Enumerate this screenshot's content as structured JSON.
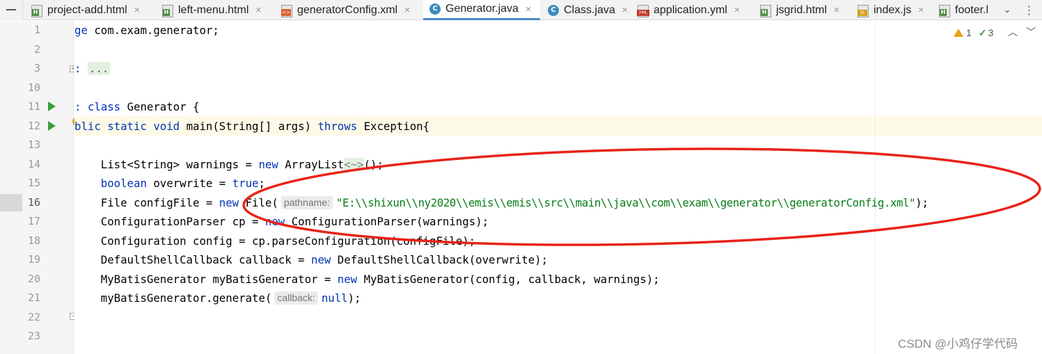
{
  "tabs": [
    {
      "label": "project-add.html",
      "icon": "html-file-icon",
      "close": "×"
    },
    {
      "label": "left-menu.html",
      "icon": "html-file-icon",
      "close": "×"
    },
    {
      "label": "generatorConfig.xml",
      "icon": "xml-file-icon",
      "close": "×"
    },
    {
      "label": "Generator.java",
      "icon": "java-class-icon",
      "close": "×",
      "active": true
    },
    {
      "label": "Class.java",
      "icon": "java-class-icon",
      "close": "×"
    },
    {
      "label": "application.yml",
      "icon": "yml-file-icon",
      "close": "×"
    },
    {
      "label": "jsgrid.html",
      "icon": "html-file-icon",
      "close": "×"
    },
    {
      "label": "index.js",
      "icon": "js-file-icon",
      "close": "×"
    },
    {
      "label": "footer.l",
      "icon": "html-file-icon"
    }
  ],
  "tabs_more_glyph": "⌄",
  "tabs_options_glyph": "⋮",
  "inspection": {
    "warnings": "1",
    "ok": "3",
    "warn_icon": "warning-icon",
    "ok_icon": "check-icon"
  },
  "line_numbers": [
    "1",
    "2",
    "3",
    "10",
    "11",
    "12",
    "13",
    "14",
    "15",
    "16",
    "17",
    "18",
    "19",
    "20",
    "21",
    "22",
    "23"
  ],
  "current_line": "16",
  "code": {
    "l1_a": "ge",
    "l1_b": " com.exam.generator;",
    "l3_a": ": ",
    "l3_b": "...",
    "l11_a": ": class",
    "l11_b": " Generator {",
    "l12_a": "blic static void",
    "l12_b": " main(String[] args) ",
    "l12_c": "throws",
    "l12_d": " Exception{",
    "l14_a": "    List<String> warnings = ",
    "l14_b": "new",
    "l14_c": " ArrayList",
    "l14_d": "<~>",
    "l14_e": "();",
    "l15_a": "    ",
    "l15_b": "boolean",
    "l15_c": " overwrite = ",
    "l15_d": "true",
    "l15_e": ";",
    "l16_a": "    File configFile = ",
    "l16_b": "new",
    "l16_c": " File(",
    "l16_hint": "pathname:",
    "l16_str": "\"E:\\\\shixun\\\\ny2020\\\\emis\\\\emis\\\\src\\\\main\\\\java\\\\com\\\\exam\\\\generator\\\\generatorConfig.xml\"",
    "l16_end": ");",
    "l17_a": "    ConfigurationParser cp = ",
    "l17_b": "new",
    "l17_c": " ConfigurationParser(warnings);",
    "l18_a": "    Configuration config = cp.parseConfiguration(configFile);",
    "l19_a": "    DefaultShellCallback callback = ",
    "l19_b": "new",
    "l19_c": " DefaultShellCallback(overwrite);",
    "l20_a": "    MyBatisGenerator myBatisGenerator = ",
    "l20_b": "new",
    "l20_c": " MyBatisGenerator(config, callback, warnings);",
    "l21_a": "    myBatisGenerator.generate(",
    "l21_hint": "callback:",
    "l21_b": "null",
    "l21_c": ");"
  },
  "annotation_color": "#e8231a",
  "keyword_color": "#0033b3",
  "string_color": "#067d17",
  "watermark": "CSDN @小鸡仔学代码"
}
